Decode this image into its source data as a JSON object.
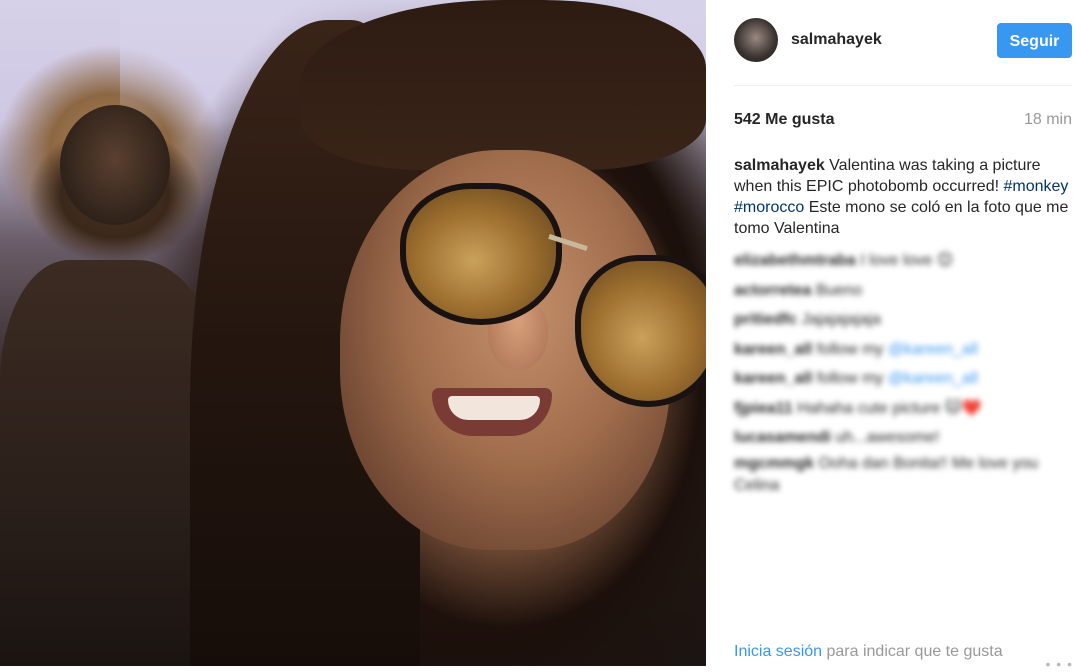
{
  "post": {
    "photo_icon": "photo",
    "username": "salmahayek",
    "follow_label": "Seguir",
    "likes": "542 Me gusta",
    "time": "18 min",
    "caption": {
      "author": "salmahayek",
      "text_1": " Valentina was taking a picture when this EPIC photobomb occurred! ",
      "tag_1": "#monkey",
      "space": " ",
      "tag_2": "#morocco",
      "text_2": " Este mono se coló en la foto que me tomo Valentina"
    },
    "comments": [
      {
        "user": "elizabethmtraba",
        "text": " I love love 😊"
      },
      {
        "user": "actorretea",
        "text": " Bueno"
      },
      {
        "user": "pritiedfc",
        "text": " Jajajajajaja"
      },
      {
        "user": "kareen_all",
        "text": " follow my ",
        "tag": "@kareen_all"
      },
      {
        "user": "kareen_all",
        "text": " follow my ",
        "tag": "@kareen_all"
      },
      {
        "user": "fjpiea11",
        "text": " Hahaha cute picture 🐱❤️"
      },
      {
        "user": "lucasamendi",
        "text": " uh...awesome!"
      },
      {
        "user": "mgcmmgk",
        "text": " Ooha dan Bonita!! Me love you Celina"
      }
    ],
    "login": {
      "link": "Inicia sesión",
      "text": " para indicar que te gusta"
    },
    "more_label": "• • •"
  }
}
